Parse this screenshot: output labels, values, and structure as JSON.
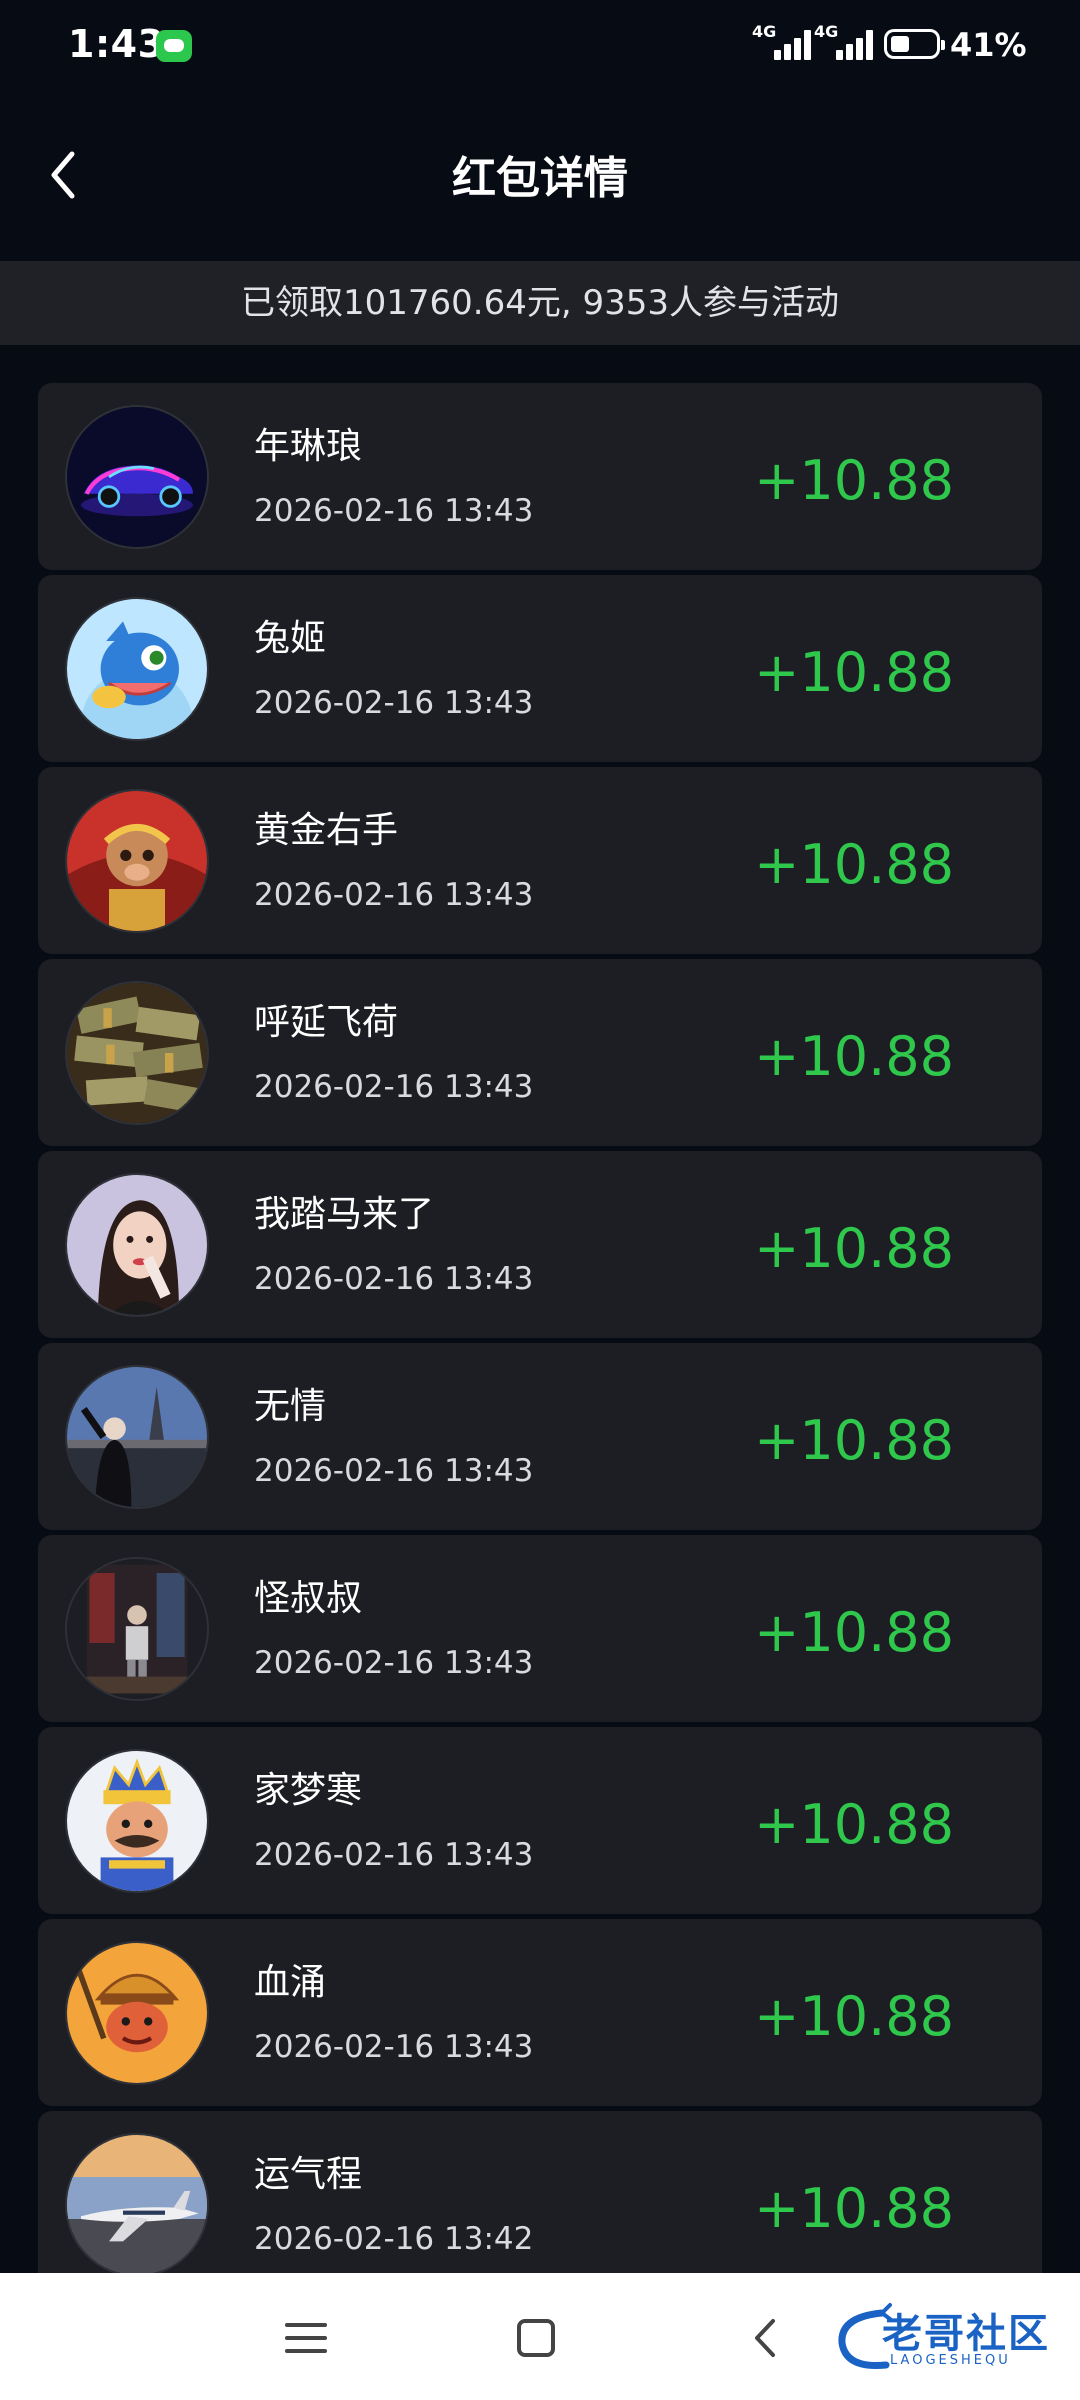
{
  "status_bar": {
    "time": "1:43",
    "network_1": "4G",
    "network_2": "4G",
    "battery_percent": "41%",
    "battery_level": 0.41,
    "notification_icon": "message-icon"
  },
  "header": {
    "title": "红包详情",
    "back_icon": "chevron-left-icon"
  },
  "summary": {
    "text": "已领取101760.64元, 9353人参与活动"
  },
  "records": [
    {
      "name": "年琳琅",
      "time": "2026-02-16 13:43",
      "amount": "+10.88",
      "avatar": "neon-car-avatar"
    },
    {
      "name": "兔姬",
      "time": "2026-02-16 13:43",
      "amount": "+10.88",
      "avatar": "blue-dragon-avatar"
    },
    {
      "name": "黄金右手",
      "time": "2026-02-16 13:43",
      "amount": "+10.88",
      "avatar": "monkey-king-avatar"
    },
    {
      "name": "呼延飞荷",
      "time": "2026-02-16 13:43",
      "amount": "+10.88",
      "avatar": "money-stack-avatar"
    },
    {
      "name": "我踏马来了",
      "time": "2026-02-16 13:43",
      "amount": "+10.88",
      "avatar": "woman-portrait-avatar"
    },
    {
      "name": "无情",
      "time": "2026-02-16 13:43",
      "amount": "+10.88",
      "avatar": "paris-photo-avatar"
    },
    {
      "name": "怪叔叔",
      "time": "2026-02-16 13:43",
      "amount": "+10.88",
      "avatar": "room-photo-avatar"
    },
    {
      "name": "家梦寒",
      "time": "2026-02-16 13:43",
      "amount": "+10.88",
      "avatar": "cartoon-king-avatar"
    },
    {
      "name": "血涌",
      "time": "2026-02-16 13:43",
      "amount": "+10.88",
      "avatar": "cartoon-warrior-avatar"
    },
    {
      "name": "运气程",
      "time": "2026-02-16 13:42",
      "amount": "+10.88",
      "avatar": "jet-plane-avatar"
    }
  ],
  "nav_bar": {
    "buttons": [
      "menu-icon",
      "home-square-icon",
      "back-chevron-icon"
    ],
    "watermark_text": "老哥社区",
    "watermark_sub": "LAOGESHEQU"
  },
  "colors": {
    "background": "#070b13",
    "card": "#1c1e23",
    "summary_bg": "#1f2126",
    "amount_green": "#2fc74c",
    "watermark_blue": "#1a63c4"
  }
}
